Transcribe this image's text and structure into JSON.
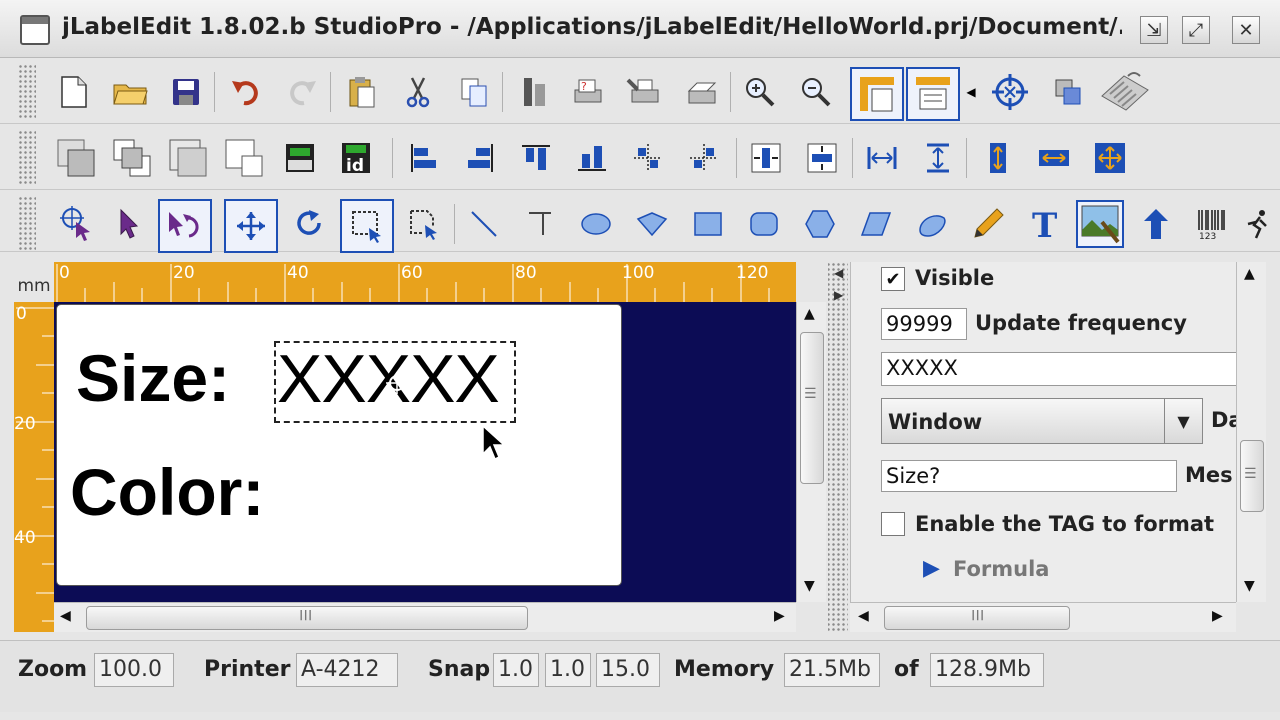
{
  "window": {
    "title": "jLabelEdit 1.8.02.b StudioPro - /Applications/jLabelEdit/HelloWorld.prj/Document/..."
  },
  "ruler": {
    "unit": "mm",
    "h_ticks": [
      "0",
      "20",
      "40",
      "60",
      "80",
      "100",
      "120"
    ],
    "v_ticks": [
      "0",
      "20",
      "40"
    ]
  },
  "label": {
    "size_text": "Size:",
    "color_text": "Color:",
    "field_text": "XXXXX"
  },
  "properties": {
    "visible_label": "Visible",
    "visible_checked": "✔",
    "update_frequency_value": "99999",
    "update_frequency_label": "Update frequency",
    "text_value": "XXXXX",
    "datasource_value": "Window",
    "datasource_label": "Da",
    "message_value": "Size?",
    "message_label": "Mes",
    "tag_format_label": "Enable the TAG to format",
    "formula_label": "Formula"
  },
  "status": {
    "zoom_label": "Zoom",
    "zoom_value": "100.0",
    "printer_label": "Printer",
    "printer_value": "A-4212",
    "snap_label": "Snap",
    "snap_x": "1.0",
    "snap_y": "1.0",
    "snap_angle": "15.0",
    "memory_label": "Memory",
    "memory_used": "21.5Mb",
    "of_label": "of",
    "memory_total": "128.9Mb"
  },
  "colors": {
    "ruler": "#e8a21c",
    "canvas": "#0c0c55",
    "selection": "#1d4fb5"
  },
  "icons": {
    "toolbar1": [
      "new-document-icon",
      "open-folder-icon",
      "save-icon",
      "undo-icon",
      "redo-icon",
      "paste-icon",
      "cut-icon",
      "copy-icon",
      "properties-icon",
      "print-settings-icon",
      "printer-setup-icon",
      "print-icon",
      "zoom-in-icon",
      "zoom-out-icon",
      "page-layout-icon",
      "page-margin-icon",
      "target-icon",
      "duplicate-icon",
      "keyboard-icon"
    ],
    "toolbar2": [
      "bring-front-icon",
      "send-back-icon",
      "shadow-front-icon",
      "shadow-back-icon",
      "sdk-icon",
      "id-icon",
      "align-left-icon",
      "align-right-icon",
      "align-top-icon",
      "align-bottom-icon",
      "center-h-icon",
      "center-v-icon",
      "distribute-h-icon",
      "distribute-v-icon",
      "space-h-icon",
      "space-v-icon",
      "height-icon",
      "width-icon",
      "size-both-icon"
    ],
    "toolbar3": [
      "target-pointer-icon",
      "pointer-icon",
      "rotate-pointer-icon",
      "move-icon",
      "refresh-icon",
      "select-area-icon",
      "select-shape-icon",
      "line-icon",
      "tline-icon",
      "ellipse-icon",
      "diamond-icon",
      "rectangle-icon",
      "rounded-rect-icon",
      "hexagon-icon",
      "parallelogram-icon",
      "blob-icon",
      "pencil-icon",
      "text-icon",
      "image-icon",
      "arrow-up-icon",
      "barcode-icon",
      "runner-icon"
    ]
  }
}
